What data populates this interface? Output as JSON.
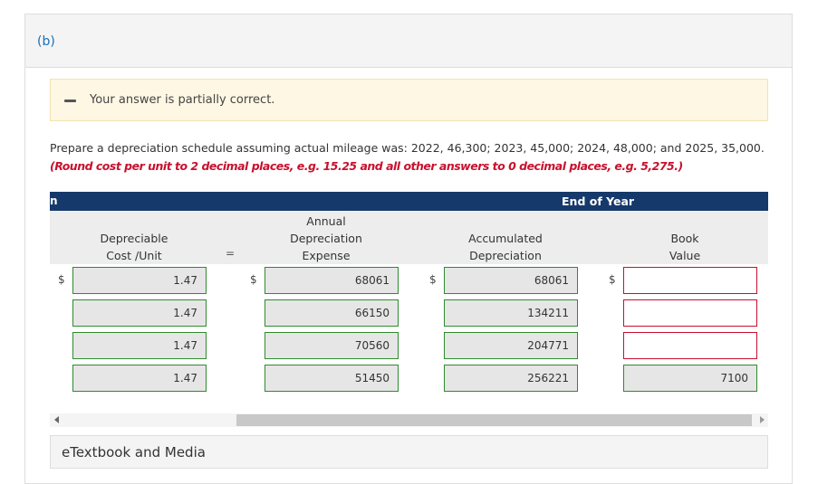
{
  "part_label": "(b)",
  "feedback": {
    "icon": "minus-icon",
    "text": "Your answer is partially correct."
  },
  "question": "Prepare a depreciation schedule assuming actual mileage was: 2022, 46,300; 2023, 45,000; 2024, 48,000; and 2025, 35,000.",
  "instruction": "(Round cost per unit to 2 decimal places, e.g. 15.25 and all other answers to 0 decimal places, e.g. 5,275.)",
  "table": {
    "left_fragment": "n",
    "end_of_year_label": "End of Year",
    "headers": {
      "cost_unit": "Depreciable\nCost /Unit",
      "annual": "Annual\nDepreciation\nExpense",
      "accumulated": "Accumulated\nDepreciation",
      "book": "Book\nValue"
    },
    "equals": "=",
    "currency": "$",
    "rows": [
      {
        "cost_unit": "1.47",
        "annual": "68061",
        "accumulated": "68061",
        "book": ""
      },
      {
        "cost_unit": "1.47",
        "annual": "66150",
        "accumulated": "134211",
        "book": ""
      },
      {
        "cost_unit": "1.47",
        "annual": "70560",
        "accumulated": "204771",
        "book": ""
      },
      {
        "cost_unit": "1.47",
        "annual": "51450",
        "accumulated": "256221",
        "book": "7100"
      }
    ],
    "status_colors": {
      "correct": "#2e8b2e",
      "incorrect": "#c8102e"
    }
  },
  "etextbook_label": "eTextbook and Media",
  "colors": {
    "header_bar": "#16396b",
    "part_label": "#1a6fb5",
    "alert_bg": "#fdf7e4",
    "instruction": "#c8102e"
  }
}
